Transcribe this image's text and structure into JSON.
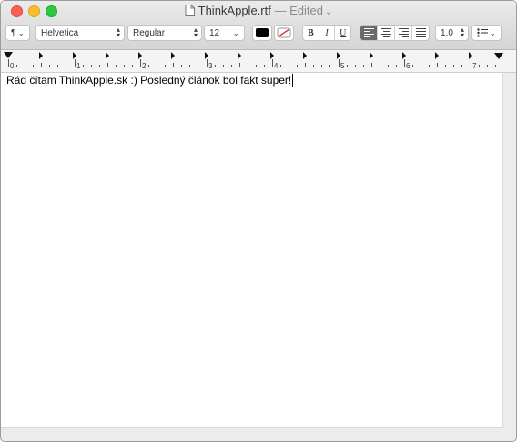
{
  "window": {
    "filename": "ThinkApple.rtf",
    "status": "— Edited"
  },
  "toolbar": {
    "paragraph_style_symbol": "¶",
    "font_family": "Helvetica",
    "font_style": "Regular",
    "font_size": "12",
    "text_color": "#000000",
    "bold_label": "B",
    "italic_label": "I",
    "underline_label": "U",
    "line_spacing": "1.0",
    "alignment_selected": "left"
  },
  "ruler": {
    "numbers": [
      "0",
      "1",
      "2",
      "3",
      "4",
      "5",
      "6",
      "7"
    ]
  },
  "document": {
    "text": "Rád čítam ThinkApple.sk :) Posledný článok bol fakt super!"
  },
  "icons": {
    "file": "document-icon",
    "list": "list-bullets-icon"
  }
}
